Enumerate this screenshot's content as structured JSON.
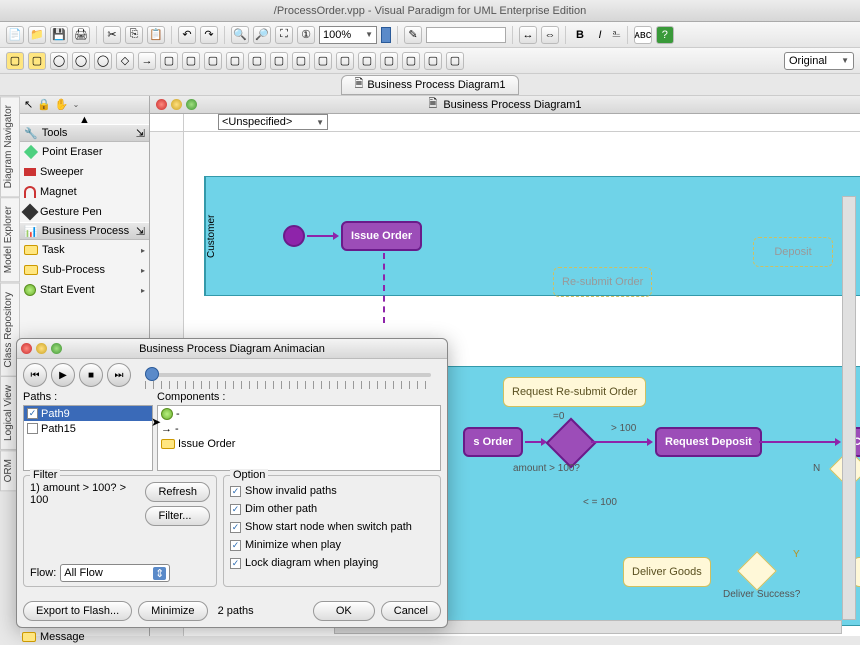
{
  "app": {
    "title": "/ProcessOrder.vpp - Visual Paradigm for UML Enterprise Edition"
  },
  "zoom": {
    "value": "100%"
  },
  "original_dropdown": "Original",
  "doc_tab": {
    "label": "Business Process Diagram1"
  },
  "canvas": {
    "title": "Business Process Diagram1"
  },
  "unspecified": "<Unspecified>",
  "side_tabs": [
    "Diagram Navigator",
    "Model Explorer",
    "Class Repository",
    "Logical View",
    "ORM"
  ],
  "tools": {
    "header": "Tools",
    "items": [
      "Point Eraser",
      "Sweeper",
      "Magnet",
      "Gesture Pen"
    ]
  },
  "bp": {
    "header": "Business Process",
    "items": [
      "Task",
      "Sub-Process",
      "Start Event"
    ]
  },
  "lanes": {
    "customer": "Customer"
  },
  "nodes": {
    "issue_order": "Issue Order",
    "resubmit": "Re-submit Order",
    "deposit": "Deposit",
    "req_resubmit": "Request Re-submit Order",
    "s_order": "s Order",
    "req_deposit": "Request Deposit",
    "cancel": "Canc",
    "deliver": "Deliver Goods",
    "c_node": "C"
  },
  "edge_labels": {
    "amt_q": "amount > 100?",
    "gt100": "> 100",
    "eq0": "=0",
    "le100": "< = 100",
    "n": "N",
    "y": "Y",
    "deliver_success": "Deliver Success?"
  },
  "dialog": {
    "title": "Business Process Diagram Animacian",
    "paths_label": "Paths :",
    "components_label": "Components :",
    "paths": [
      "Path9",
      "Path15"
    ],
    "components": [
      "-",
      "-",
      "Issue Order"
    ],
    "filter": {
      "legend": "Filter",
      "line1": "1) amount > 100? > 100",
      "refresh": "Refresh",
      "filter_btn": "Filter...",
      "flow_label": "Flow:",
      "flow_value": "All Flow"
    },
    "option": {
      "legend": "Option",
      "items": [
        "Show invalid paths",
        "Dim other path",
        "Show start node when switch path",
        "Minimize when play",
        "Lock diagram when playing"
      ]
    },
    "export": "Export to Flash...",
    "minimize": "Minimize",
    "count": "2 paths",
    "ok": "OK",
    "cancel": "Cancel"
  },
  "bottom_item": "Message"
}
